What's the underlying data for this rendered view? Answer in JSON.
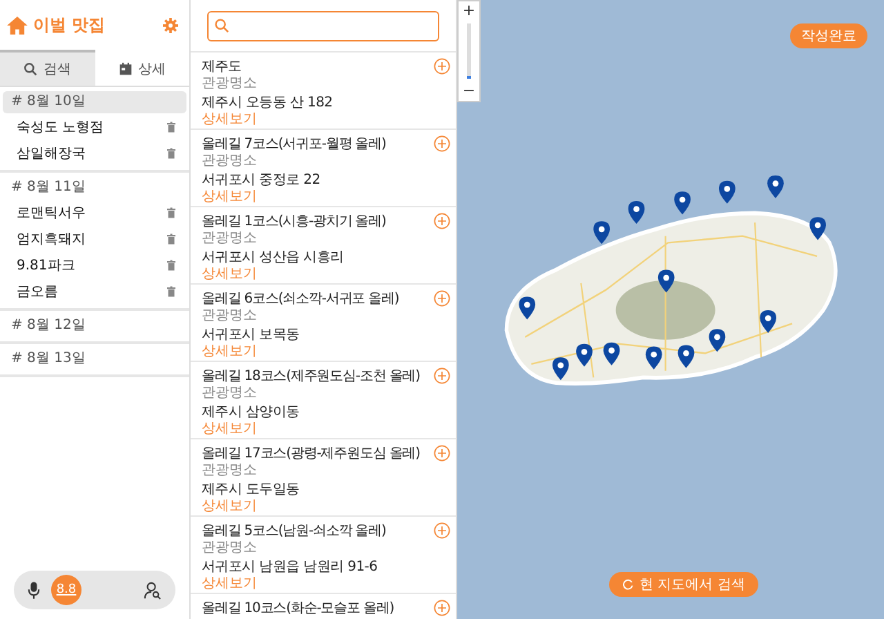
{
  "sidebar": {
    "title": "이벌 맛집",
    "tabs": [
      {
        "label": "검색",
        "selected": true
      },
      {
        "label": "상세",
        "selected": false
      }
    ],
    "days": [
      {
        "label": "# 8월 10일",
        "selected": true,
        "children": [
          {
            "name": "숙성도 노형점"
          },
          {
            "name": "삼일해장국"
          }
        ]
      },
      {
        "label": "# 8월 11일",
        "selected": false,
        "children": [
          {
            "name": "로맨틱서우"
          },
          {
            "name": "엄지흑돼지"
          },
          {
            "name": "9.81파크"
          },
          {
            "name": "금오름"
          }
        ]
      },
      {
        "label": "# 8월 12일",
        "selected": false
      },
      {
        "label": "# 8월 13일",
        "selected": false
      }
    ],
    "voice_bar": {
      "badge": "8.8"
    }
  },
  "results": {
    "items": [
      {
        "name": "제주도",
        "category": "관광명소",
        "address": "제주시 오등동 산 182",
        "link": "상세보기"
      },
      {
        "name": "올레길 7코스(서귀포-월평 올레)",
        "category": "관광명소",
        "address": "서귀포시 중정로 22",
        "link": "상세보기"
      },
      {
        "name": "올레길 1코스(시흥-광치기 올레)",
        "category": "관광명소",
        "address": "서귀포시 성산읍 시흥리",
        "link": "상세보기"
      },
      {
        "name": "올레길 6코스(쇠소깍-서귀포 올레)",
        "category": "관광명소",
        "address": "서귀포시 보목동",
        "link": "상세보기"
      },
      {
        "name": "올레길 18코스(제주원도심-조천 올레)",
        "category": "관광명소",
        "address": "제주시 삼양이동",
        "link": "상세보기"
      },
      {
        "name": "올레길 17코스(광령-제주원도심 올레)",
        "category": "관광명소",
        "address": "제주시 도두일동",
        "link": "상세보기"
      },
      {
        "name": "올레길 5코스(남원-쇠소깍 올레)",
        "category": "관광명소",
        "address": "서귀포시 남원읍 남원리 91-6",
        "link": "상세보기"
      },
      {
        "name": "올레길 10코스(화순-모슬포 올레)"
      }
    ]
  },
  "map": {
    "zoom": {
      "in": "+",
      "out": "−",
      "level": 0.05
    },
    "done_button": "작성완료",
    "search_button": "현 지도에서 검색"
  }
}
